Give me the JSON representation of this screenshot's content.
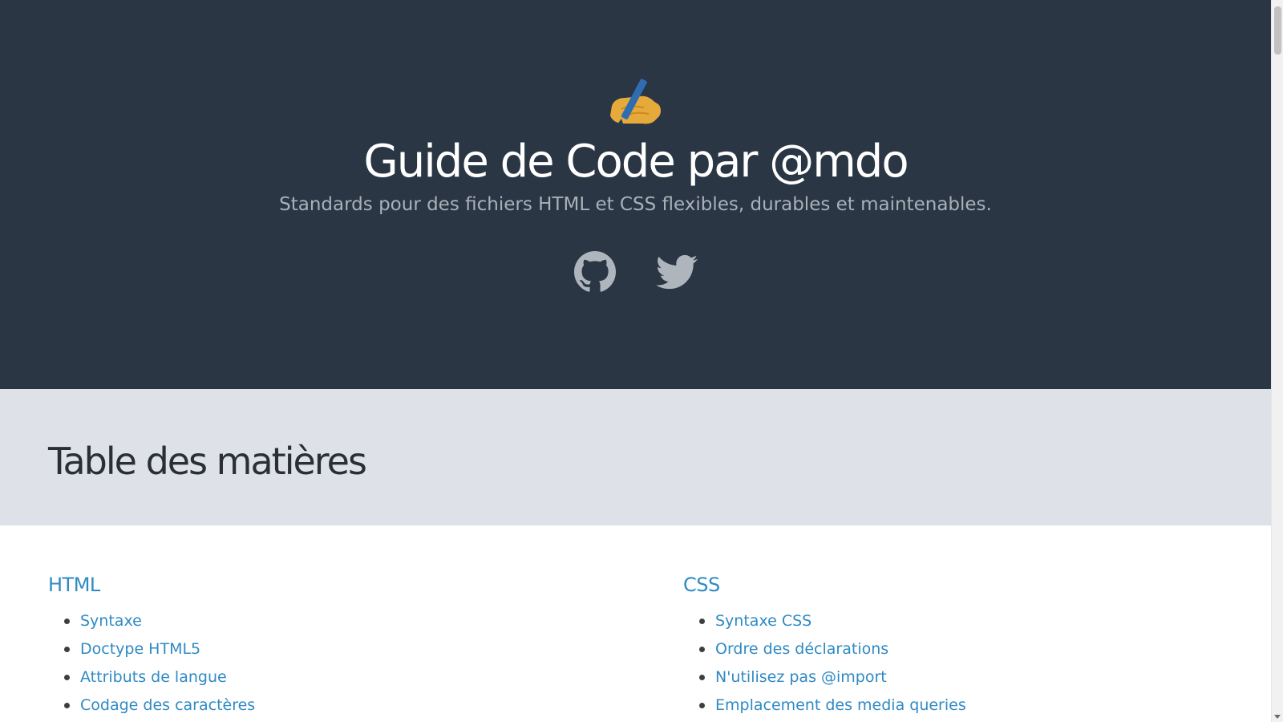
{
  "header": {
    "icon": "writing-hand-icon",
    "title": "Guide de Code par @mdo",
    "subtitle": "Standards pour des fichiers HTML et CSS flexibles, durables et maintenables.",
    "social": [
      {
        "icon": "github-icon"
      },
      {
        "icon": "twitter-icon"
      }
    ],
    "background_color": "#2a3643"
  },
  "toc": {
    "title": "Table des matières",
    "band_color": "#dee1e8",
    "link_color": "#2f8ac4",
    "sections": [
      {
        "heading": "HTML",
        "items": [
          "Syntaxe",
          "Doctype HTML5",
          "Attributs de langue",
          "Codage des caractères"
        ]
      },
      {
        "heading": "CSS",
        "items": [
          "Syntaxe CSS",
          "Ordre des déclarations",
          "N'utilisez pas @import",
          "Emplacement des media queries"
        ]
      }
    ]
  }
}
